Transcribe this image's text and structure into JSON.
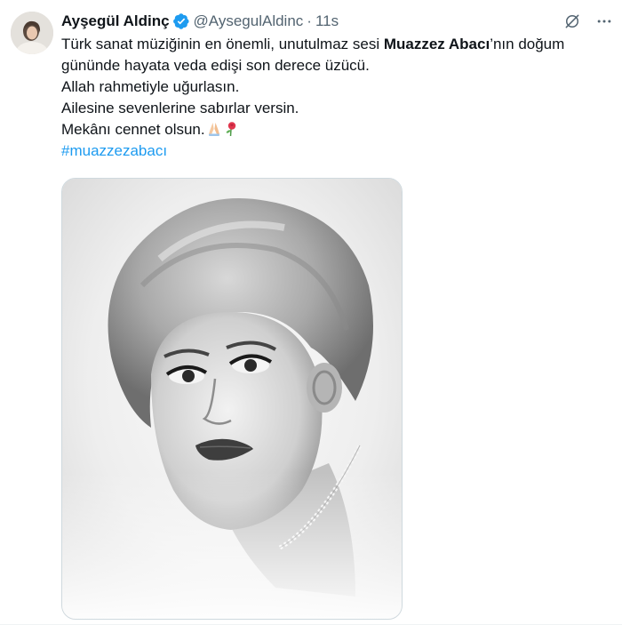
{
  "author": {
    "name": "Ayşegül Aldinç",
    "handle": "@AysegulAldinc",
    "separator": "·",
    "time": "11s",
    "verified_color": "#1d9bf0"
  },
  "tweet": {
    "line1_start": "Türk sanat müziğinin en önemli, unutulmaz sesi ",
    "line1_bold": "Muazzez Abacı",
    "line1_end": "’nın doğum günündе hayata veda edişi son derece üzücü.",
    "line2": "Allah rahmetiyle uğurlasın.",
    "line3": "Ailesine sevenlerine sabırlar versin.",
    "line4": "Mekânı cennet olsun.",
    "line4_emojis": [
      "pray-emoji",
      "rose-emoji"
    ],
    "hashtag": "#muazzezabacı"
  },
  "media": {
    "kind": "black-and-white portrait photo"
  },
  "icons": {
    "grok": "grok-icon",
    "more": "more-icon"
  },
  "colors": {
    "text": "#0f1419",
    "secondary": "#536471",
    "link": "#1d9bf0",
    "border": "#cfd9de"
  }
}
